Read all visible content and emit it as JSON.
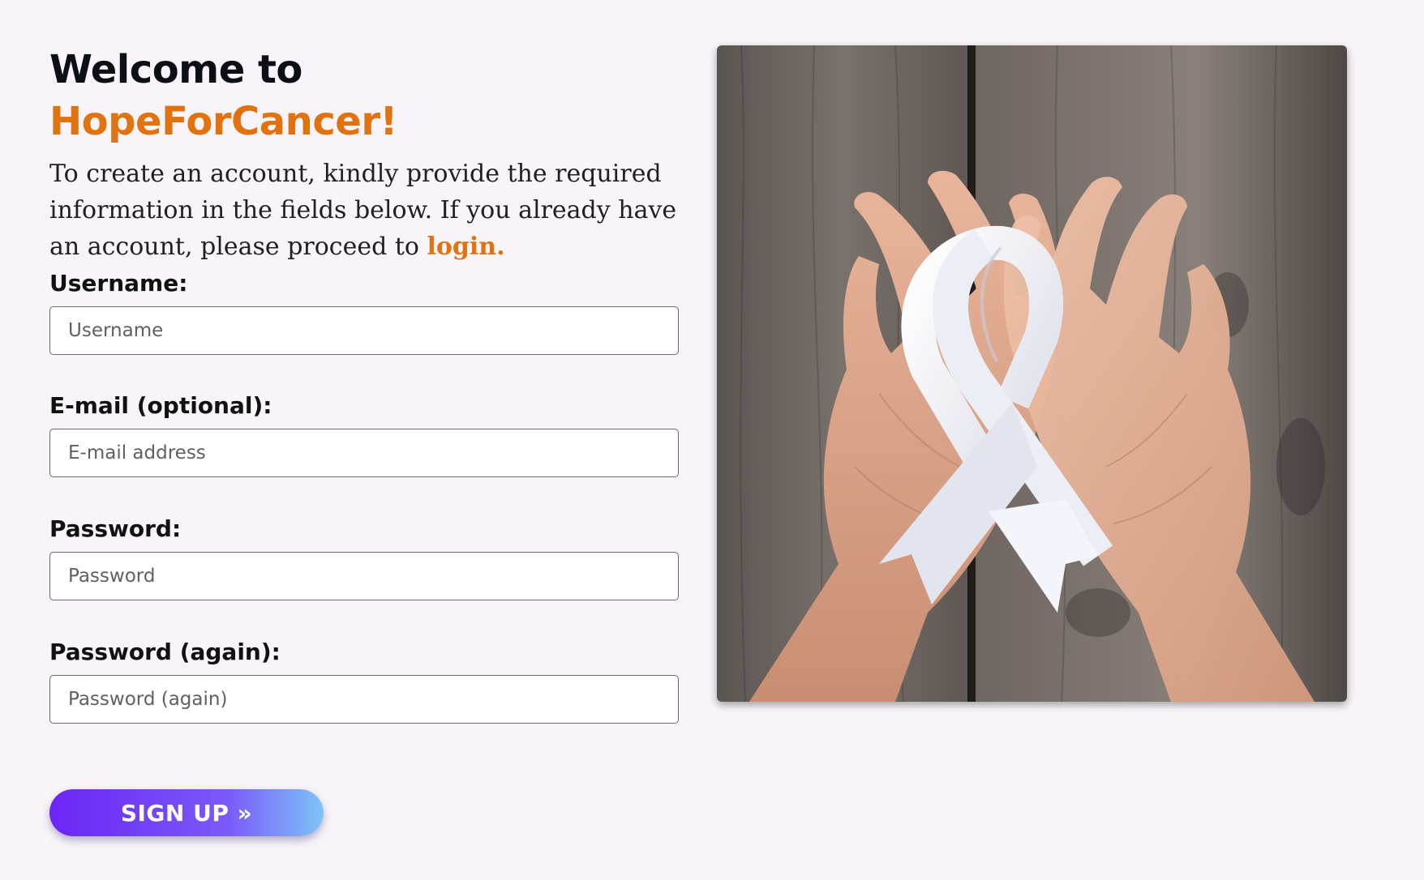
{
  "header": {
    "title_line1": "Welcome to",
    "title_line2": "HopeForCancer!"
  },
  "intro": {
    "text": "To create an account, kindly provide the required information in the fields below. If you already have an account, please proceed to ",
    "login_link": "login."
  },
  "form": {
    "username": {
      "label": "Username:",
      "placeholder": "Username",
      "value": ""
    },
    "email": {
      "label": "E-mail (optional):",
      "placeholder": "E-mail address",
      "value": ""
    },
    "password": {
      "label": "Password:",
      "placeholder": "Password",
      "value": ""
    },
    "password_again": {
      "label": "Password (again):",
      "placeholder": "Password (again)",
      "value": ""
    },
    "submit_label": "SIGN UP »"
  },
  "colors": {
    "background": "#f8f4f9",
    "accent_orange": "#e0720f",
    "button_gradient_start": "#6b25f5",
    "button_gradient_end": "#7ec4f8"
  },
  "image": {
    "icon": "awareness-ribbon-hands-photo"
  }
}
